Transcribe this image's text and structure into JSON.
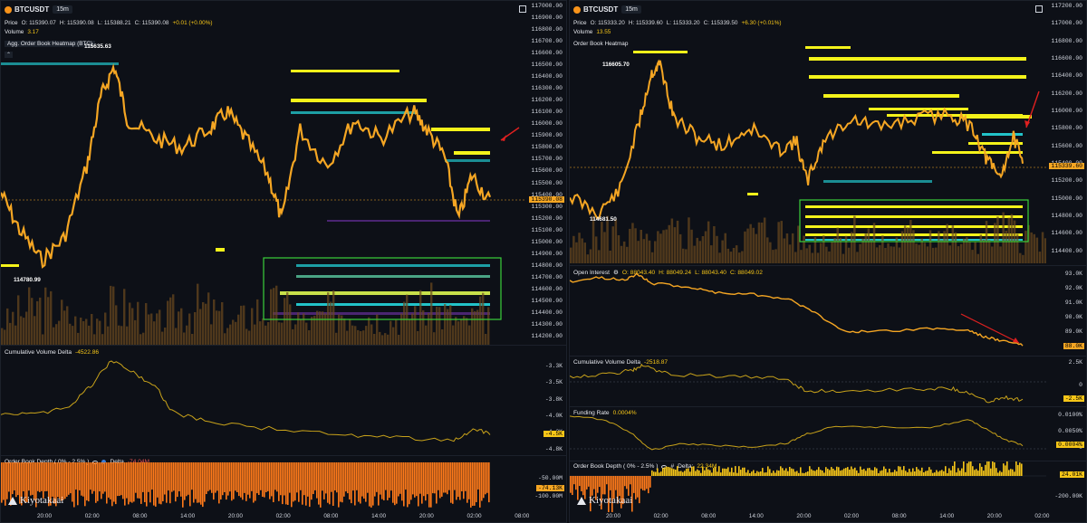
{
  "left": {
    "symbol": "BTCUSDT",
    "timeframe": "15m",
    "ohlc": {
      "label": "Price",
      "o": "O: 115390.07",
      "h": "H: 115390.08",
      "l": "L: 115388.21",
      "c": "C: 115390.08",
      "chg": "+0.01 (+0.00%)"
    },
    "volume": {
      "label": "Volume",
      "value": "3.17"
    },
    "heatmap_title": "Agg. Order Book Heatmap (BTC)",
    "high_marker": "115635.63",
    "low_marker": "114780.99",
    "price_tag": "115390.08",
    "price_axis": [
      "117000.00",
      "116900.00",
      "116800.00",
      "116700.00",
      "116600.00",
      "116500.00",
      "116400.00",
      "116300.00",
      "116200.00",
      "116100.00",
      "116000.00",
      "115900.00",
      "115800.00",
      "115700.00",
      "115600.00",
      "115500.00",
      "115400.00",
      "115300.00",
      "115200.00",
      "115100.00",
      "115000.00",
      "114900.00",
      "114800.00",
      "114700.00",
      "114600.00",
      "114500.00",
      "114400.00",
      "114300.00",
      "114200.00"
    ],
    "cvd": {
      "title": "Cumulative Volume Delta",
      "value": "-4522.86",
      "axis": [
        "-3.3K",
        "-3.5K",
        "-3.8K",
        "-4.0K",
        "-4.3K",
        "-4.8K"
      ],
      "tag": "-4.5K"
    },
    "obd": {
      "title": "Order Book Depth ( 0% - 2.5% )",
      "delta_label": "Delta",
      "delta": "-74.04M",
      "axis": [
        "-50.00M",
        "-100.00M"
      ],
      "tag": "-74.13K"
    },
    "time_axis": [
      "20:00",
      "02:00",
      "08:00",
      "14:00",
      "20:00",
      "02:00",
      "08:00",
      "14:00",
      "20:00",
      "02:00",
      "08:00"
    ]
  },
  "right": {
    "symbol": "BTCUSDT",
    "timeframe": "15m",
    "ohlc": {
      "label": "Price",
      "o": "O: 115333.20",
      "h": "H: 115339.60",
      "l": "L: 115333.20",
      "c": "C: 115339.50",
      "chg": "+6.30 (+0.01%)"
    },
    "volume": {
      "label": "Volume",
      "value": "13.55"
    },
    "heatmap_title": "Order Book Heatmap",
    "high_marker": "116605.70",
    "low_marker": "114681.50",
    "price_tag": "115339.60",
    "price_axis": [
      "117200.00",
      "117000.00",
      "116800.00",
      "116600.00",
      "116400.00",
      "116200.00",
      "116000.00",
      "115800.00",
      "115600.00",
      "115400.00",
      "115200.00",
      "115000.00",
      "114800.00",
      "114600.00",
      "114400.00"
    ],
    "oi": {
      "title": "Open Interest",
      "o": "O: 88043.40",
      "h": "H: 88049.24",
      "l": "L: 88043.40",
      "c": "C: 88049.02",
      "axis": [
        "93.0K",
        "92.0K",
        "91.0K",
        "90.0K",
        "89.0K"
      ],
      "tag": "88.0K"
    },
    "cvd": {
      "title": "Cumulative Volume Delta",
      "value": "-2518.87",
      "axis": [
        "2.5K",
        "0"
      ],
      "tag": "-2.5K"
    },
    "funding": {
      "title": "Funding Rate",
      "value": "0.0004%",
      "axis": [
        "0.0100%",
        "0.0050%",
        "0"
      ],
      "tag": "0.0004%"
    },
    "obd": {
      "title": "Order Book Depth ( 0% - 2.5% )",
      "hash": "#",
      "delta_label": "Delta:",
      "delta": "22.34M",
      "axis": [
        "-200.00K"
      ],
      "tag": "24.01K"
    },
    "time_axis": [
      "20:00",
      "02:00",
      "08:00",
      "14:00",
      "20:00",
      "02:00",
      "08:00",
      "14:00",
      "20:00",
      "02:00"
    ]
  },
  "logo": "Kiyotakaai",
  "colors": {
    "candle": "#f5a623",
    "heat_yellow": "#f4f31a",
    "heat_cyan": "#22c3c9",
    "heat_purple": "#5a2a8a",
    "box": "#3bd03b",
    "arrow": "#e02020",
    "cvd_line": "#c8a21a"
  }
}
